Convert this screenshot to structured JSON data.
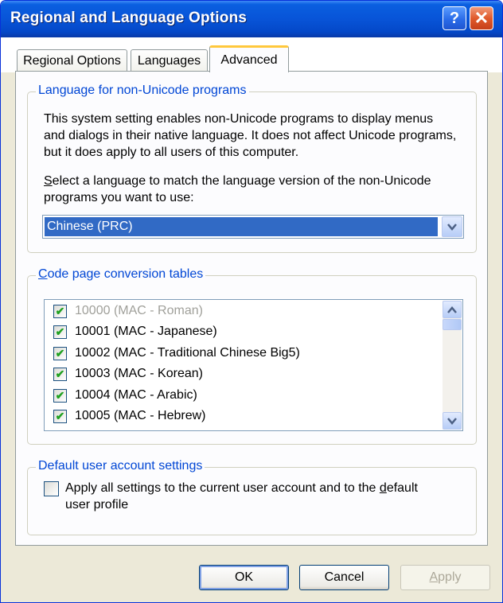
{
  "window": {
    "title": "Regional and Language Options"
  },
  "titlebar": {
    "help_glyph": "?",
    "close_glyph": "✕"
  },
  "tabs": [
    {
      "label": "Regional Options",
      "active": false
    },
    {
      "label": "Languages",
      "active": false
    },
    {
      "label": "Advanced",
      "active": true
    }
  ],
  "non_unicode": {
    "legend": "Language for non-Unicode programs",
    "description": "This system setting enables non-Unicode programs to display menus and dialogs in their native language. It does not affect Unicode programs, but it does apply to all users of this computer.",
    "select_label_accesskey": "S",
    "select_label_rest": "elect a language to match the language version of the non-Unicode programs you want to use:",
    "selected_language": "Chinese (PRC)"
  },
  "code_pages": {
    "legend_accesskey": "C",
    "legend_rest": "ode page conversion tables",
    "items": [
      {
        "label": "10000 (MAC - Roman)",
        "checked": true,
        "dimmed": true
      },
      {
        "label": "10001 (MAC - Japanese)",
        "checked": true,
        "dimmed": false
      },
      {
        "label": "10002 (MAC - Traditional Chinese Big5)",
        "checked": true,
        "dimmed": false
      },
      {
        "label": "10003 (MAC - Korean)",
        "checked": true,
        "dimmed": false
      },
      {
        "label": "10004 (MAC - Arabic)",
        "checked": true,
        "dimmed": false
      },
      {
        "label": "10005 (MAC - Hebrew)",
        "checked": true,
        "dimmed": false
      }
    ]
  },
  "default_user": {
    "legend": "Default user account settings",
    "checkbox_text_before": "Apply all settings to the current user account and to the ",
    "checkbox_text_accesskey": "d",
    "checkbox_text_after": "efault user profile",
    "checked": false
  },
  "buttons": {
    "ok": "OK",
    "cancel": "Cancel",
    "apply_accesskey": "A",
    "apply_rest": "pply"
  },
  "colors": {
    "titlebar": "#0854d8",
    "legend_text": "#0046d5",
    "selection": "#316ac5",
    "checkmark": "#21a121",
    "active_tab_accent": "#ffc83c"
  },
  "icons": {
    "help": "question-mark-icon",
    "close": "close-x-icon",
    "dropdown": "chevron-down-icon",
    "scroll_up": "arrow-up-icon",
    "scroll_down": "arrow-down-icon",
    "check": "checkmark-icon"
  }
}
